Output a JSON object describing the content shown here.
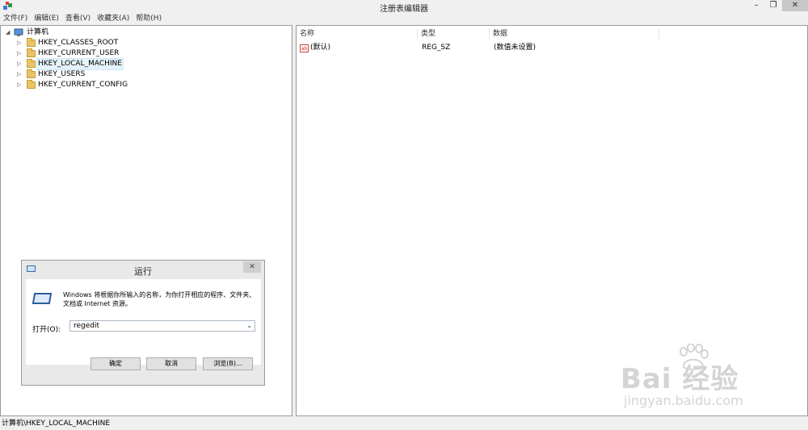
{
  "window": {
    "title": "注册表编辑器",
    "min": "–",
    "max": "❐",
    "close": "✕"
  },
  "menu": [
    "文件(F)",
    "编辑(E)",
    "查看(V)",
    "收藏夹(A)",
    "帮助(H)"
  ],
  "tree": {
    "root": "计算机",
    "items": [
      {
        "label": "HKEY_CLASSES_ROOT"
      },
      {
        "label": "HKEY_CURRENT_USER"
      },
      {
        "label": "HKEY_LOCAL_MACHINE",
        "selected": true
      },
      {
        "label": "HKEY_USERS"
      },
      {
        "label": "HKEY_CURRENT_CONFIG"
      }
    ]
  },
  "list": {
    "columns": [
      "名称",
      "类型",
      "数据"
    ],
    "rows": [
      {
        "icon": "ab",
        "name": "(默认)",
        "type": "REG_SZ",
        "data": "(数值未设置)"
      }
    ]
  },
  "status": "计算机\\HKEY_LOCAL_MACHINE",
  "run": {
    "title": "运行",
    "close": "✕",
    "desc": "Windows 将根据你所输入的名称，为你打开相应的程序、文件夹、文档或 Internet 资源。",
    "open_label": "打开(O):",
    "value": "regedit",
    "ok": "确定",
    "cancel": "取消",
    "browse": "浏览(B)..."
  },
  "watermark": {
    "brand": "Bai 经验",
    "url": "jingyan.baidu.com"
  }
}
